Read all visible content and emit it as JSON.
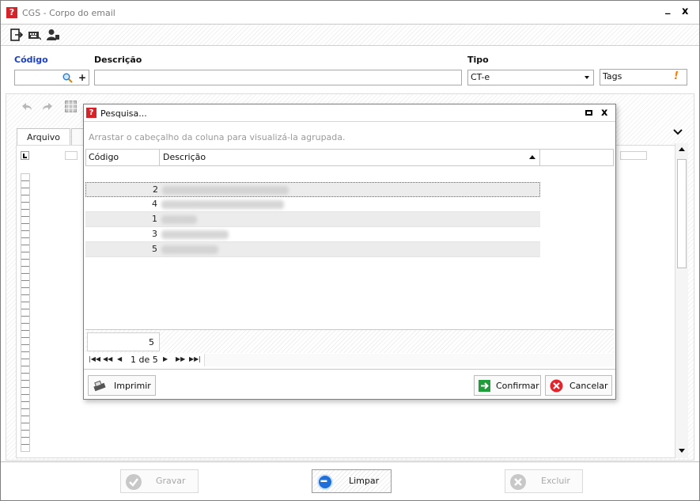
{
  "window": {
    "title": "CGS - Corpo do email",
    "minimize_glyph": "_",
    "close_glyph": "x"
  },
  "toolbar": {
    "icons": [
      "exit-icon",
      "keyboard-icon",
      "user-icon"
    ]
  },
  "form": {
    "codigo_label": "Código",
    "descricao_label": "Descrição",
    "tipo_label": "Tipo",
    "codigo_value": "",
    "descricao_value": "",
    "tipo_value": "CT-e",
    "tags_value": "Tags",
    "plus_glyph": "+",
    "warning_glyph": "!"
  },
  "editor": {
    "tab_label": "Arquivo"
  },
  "bottom": {
    "gravar_label": "Gravar",
    "limpar_label": "Limpar",
    "excluir_label": "Excluir"
  },
  "dialog": {
    "title": "Pesquisa...",
    "group_hint": "Arrastar o cabeçalho da coluna para visualizá-la agrupada.",
    "columns": [
      "Código",
      "Descrição"
    ],
    "rows": [
      {
        "codigo": "2"
      },
      {
        "codigo": "4"
      },
      {
        "codigo": "1"
      },
      {
        "codigo": "3"
      },
      {
        "codigo": "5"
      }
    ],
    "row_count": "5",
    "pager_text": "1 de 5",
    "imprimir_label": "Imprimir",
    "confirmar_label": "Confirmar",
    "cancelar_label": "Cancelar"
  },
  "colors": {
    "brand": "#d6232a",
    "label_blue": "#1a3fc8",
    "confirm_green": "#1f9d3a",
    "cancel_red": "#e0262c",
    "limpar_blue": "#1e6fd9"
  }
}
